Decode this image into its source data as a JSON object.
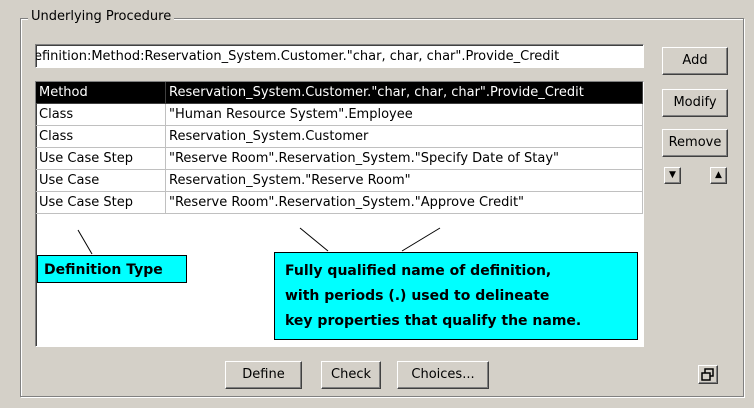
{
  "group_title": "Underlying Procedure",
  "definition_field": "efinition:Method:Reservation_System.Customer.\"char,  char,  char\".Provide_Credit",
  "rows": [
    {
      "type": "Method",
      "name": "Reservation_System.Customer.\"char,  char,  char\".Provide_Credit",
      "selected": true
    },
    {
      "type": "Class",
      "name": "\"Human Resource System\".Employee"
    },
    {
      "type": "Class",
      "name": "Reservation_System.Customer"
    },
    {
      "type": "Use Case Step",
      "name": "\"Reserve Room\".Reservation_System.\"Specify Date of Stay\""
    },
    {
      "type": "Use Case",
      "name": "Reservation_System.\"Reserve Room\""
    },
    {
      "type": "Use Case Step",
      "name": "\"Reserve Room\".Reservation_System.\"Approve Credit\""
    }
  ],
  "buttons": {
    "add": "Add",
    "modify": "Modify",
    "remove": "Remove",
    "define": "Define",
    "check": "Check",
    "choices": "Choices..."
  },
  "icons": {
    "down": "arrow-down-icon",
    "up": "arrow-up-icon",
    "restore": "restore-window-icon"
  },
  "callouts": {
    "definition_type": "Definition Type",
    "fq_line1": "Fully qualified name of definition,",
    "fq_line2": "with periods (.) used to delineate",
    "fq_line3": "key properties that qualify the name."
  },
  "colors": {
    "callout": "#00ffff",
    "selection": "#000000",
    "face": "#d4d0c8"
  }
}
